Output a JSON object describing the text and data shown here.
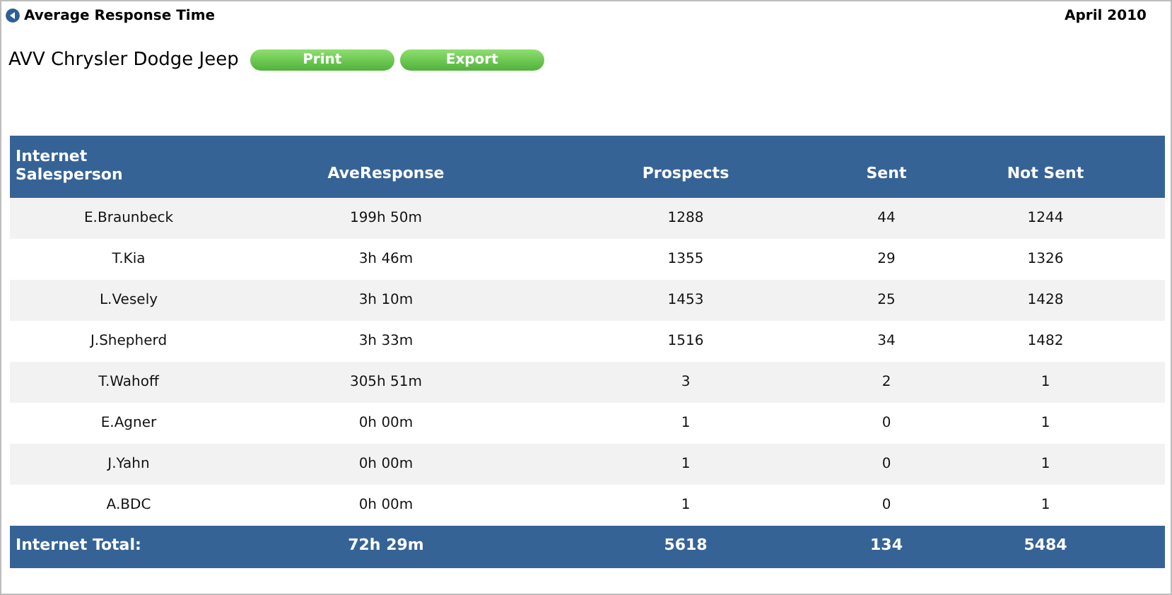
{
  "report_title": "Average Response Time",
  "period": "April 2010",
  "dealer": "AVV Chrysler Dodge Jeep",
  "buttons": [
    "Print",
    "Export"
  ],
  "table": {
    "columns": [
      "Internet Salesperson",
      "AveResponse",
      "Prospects",
      "Sent",
      "Not Sent"
    ],
    "rows": [
      [
        "E.Braunbeck",
        "199h 50m",
        "1288",
        "44",
        "1244"
      ],
      [
        "T.Kia",
        "3h 46m",
        "1355",
        "29",
        "1326"
      ],
      [
        "L.Vesely",
        "3h 10m",
        "1453",
        "25",
        "1428"
      ],
      [
        "J.Shepherd",
        "3h 33m",
        "1516",
        "34",
        "1482"
      ],
      [
        "T.Wahoff",
        "305h 51m",
        "3",
        "2",
        "1"
      ],
      [
        "E.Agner",
        "0h 00m",
        "1",
        "0",
        "1"
      ],
      [
        "J.Yahn",
        "0h 00m",
        "1",
        "0",
        "1"
      ],
      [
        "A.BDC",
        "0h 00m",
        "1",
        "0",
        "1"
      ]
    ],
    "total": [
      "Internet Total:",
      "72h 29m",
      "5618",
      "134",
      "5484"
    ]
  }
}
